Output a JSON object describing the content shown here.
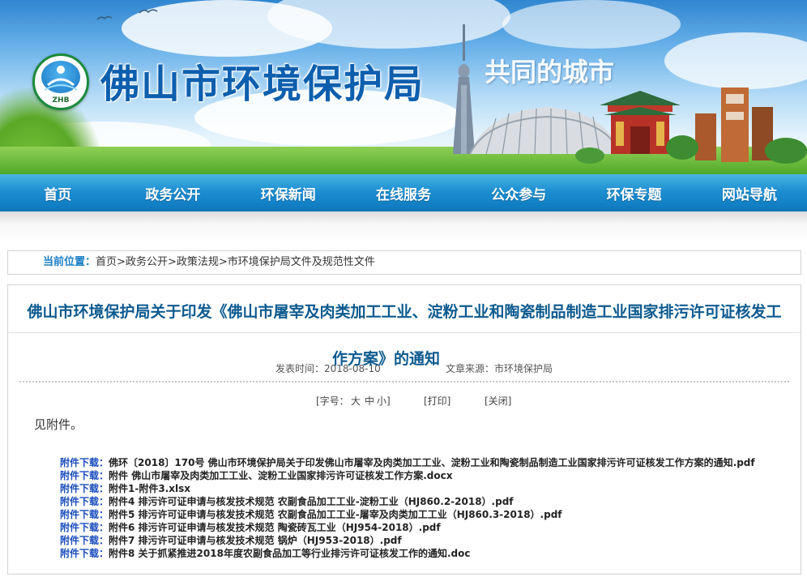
{
  "banner": {
    "site_title": "佛山市环境保护局",
    "logo_text": "ZHB",
    "slogan": "共同的城市"
  },
  "nav": {
    "items": [
      "首页",
      "政务公开",
      "环保新闻",
      "在线服务",
      "公众参与",
      "环保专题",
      "网站导航"
    ]
  },
  "breadcrumb": {
    "label": "当前位置：",
    "items": [
      "首页",
      "政务公开",
      "政策法规",
      "市环境保护局文件及规范性文件"
    ],
    "separator": ">"
  },
  "article": {
    "title_line1": "佛山市环境保护局关于印发《佛山市屠宰及肉类加工工业、淀粉工业和陶瓷制品制造工业国家排污许可证核发工",
    "title_line2": "作方案》的通知",
    "publish_time": "发表时间：2018-08-10",
    "source": "文章来源：市环境保护局",
    "font_size_label": "[字号：",
    "font_big": "大",
    "font_mid": "中",
    "font_small": "小]",
    "print": "[打印]",
    "close": "[关闭]",
    "body": "见附件。",
    "attachment_label": "附件下载：",
    "attachments": [
      "佛环〔2018〕170号 佛山市环境保护局关于印发佛山市屠宰及肉类加工工业、淀粉工业和陶瓷制品制造工业国家排污许可证核发工作方案的通知.pdf",
      "附件 佛山市屠宰及肉类加工工业、淀粉工业国家排污许可证核发工作方案.docx",
      "附件1-附件3.xlsx",
      "附件4 排污许可证申请与核发技术规范 农副食品加工工业-淀粉工业（HJ860.2-2018）.pdf",
      "附件5 排污许可证申请与核发技术规范 农副食品加工工业-屠宰及肉类加工工业（HJ860.3-2018）.pdf",
      "附件6 排污许可证申请与核发技术规范 陶瓷砖瓦工业（HJ954-2018）.pdf",
      "附件7 排污许可证申请与核发技术规范 锅炉（HJ953-2018）.pdf",
      "附件8 关于抓紧推进2018年度农副食品加工等行业排污许可证核发工作的通知.doc"
    ]
  },
  "colors": {
    "nav_bg": "#1d8fd1",
    "title_blue": "#0d5fae",
    "article_title": "#0d5a8f",
    "attachment_label": "#1a4dbd"
  }
}
